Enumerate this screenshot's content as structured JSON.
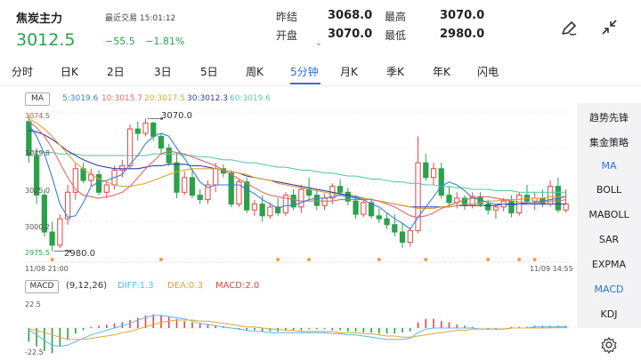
{
  "header": {
    "title": "焦炭主力",
    "last_trade": "最近交易 15:01:12",
    "price": "3012.5",
    "change": "−55.5",
    "change_pct": "−1.81%",
    "quote": {
      "prev_close_label": "昨结",
      "prev_close": "3068.0",
      "open_label": "开盘",
      "open": "3070.0",
      "high_label": "最高",
      "high": "3070.0",
      "low_label": "最低",
      "low": "2980.0"
    },
    "price_color": "#2aa14b"
  },
  "tabs": [
    {
      "label": "分时"
    },
    {
      "label": "日K"
    },
    {
      "label": "2日"
    },
    {
      "label": "3日"
    },
    {
      "label": "5日"
    },
    {
      "label": "周K"
    },
    {
      "label": "5分钟",
      "active": true
    },
    {
      "label": "月K"
    },
    {
      "label": "季K"
    },
    {
      "label": "年K"
    },
    {
      "label": "闪电"
    }
  ],
  "indicators": [
    {
      "label": "趋势先锋"
    },
    {
      "label": "集金策略"
    },
    {
      "label": "MA",
      "active": true
    },
    {
      "label": "BOLL"
    },
    {
      "label": "MABOLL"
    },
    {
      "label": "SAR"
    },
    {
      "label": "EXPMA"
    },
    {
      "label": "MACD",
      "active": true
    },
    {
      "label": "KDJ"
    }
  ],
  "icons": {
    "edit": "pen-icon",
    "collapse": "collapse-arrows-icon",
    "settings": "gear-icon"
  },
  "chart_data": [
    {
      "type": "candlestick",
      "title": "MA",
      "legend": [
        {
          "text": "5:3019.6",
          "color": "#3b7fd4"
        },
        {
          "text": "10:3015.7",
          "color": "#e06a6a"
        },
        {
          "text": "20:3017.5",
          "color": "#e3a33a"
        },
        {
          "text": "30:3012.3",
          "color": "#2c3fa8"
        },
        {
          "text": "60:3019.6",
          "color": "#5ccab0"
        }
      ],
      "y_ticks": [
        "3074.5",
        "3049.8",
        "3025.0",
        "3000.2",
        "2975.5"
      ],
      "ylim": [
        2975.5,
        3074.5
      ],
      "x_ticks": [
        "11/08 21:00",
        "11/09 14:55"
      ],
      "annotations": [
        {
          "text": "3070.0"
        },
        {
          "text": "2980.0"
        }
      ],
      "up_color": "#e04848",
      "down_color": "#2aa14b",
      "candles": [
        [
          3068,
          3072,
          3040,
          3045
        ],
        [
          3045,
          3050,
          3012,
          3018
        ],
        [
          3018,
          3022,
          2990,
          2993
        ],
        [
          2993,
          3000,
          2980,
          2984
        ],
        [
          2984,
          3005,
          2982,
          3002
        ],
        [
          3002,
          3025,
          2998,
          3020
        ],
        [
          3020,
          3040,
          3015,
          3036
        ],
        [
          3036,
          3040,
          3026,
          3028
        ],
        [
          3028,
          3036,
          3024,
          3032
        ],
        [
          3032,
          3035,
          3018,
          3020
        ],
        [
          3020,
          3027,
          3016,
          3025
        ],
        [
          3025,
          3038,
          3022,
          3035
        ],
        [
          3035,
          3042,
          3030,
          3038
        ],
        [
          3038,
          3066,
          3036,
          3063
        ],
        [
          3063,
          3068,
          3055,
          3060
        ],
        [
          3060,
          3070,
          3058,
          3067
        ],
        [
          3067,
          3068,
          3055,
          3058
        ],
        [
          3058,
          3060,
          3046,
          3050
        ],
        [
          3050,
          3053,
          3038,
          3040
        ],
        [
          3040,
          3047,
          3016,
          3020
        ],
        [
          3020,
          3034,
          3018,
          3030
        ],
        [
          3030,
          3036,
          3016,
          3018
        ],
        [
          3018,
          3022,
          3012,
          3015
        ],
        [
          3015,
          3028,
          3012,
          3025
        ],
        [
          3025,
          3040,
          3020,
          3036
        ],
        [
          3036,
          3039,
          3030,
          3033
        ],
        [
          3033,
          3035,
          3010,
          3012
        ],
        [
          3012,
          3029,
          3010,
          3027
        ],
        [
          3027,
          3030,
          3006,
          3008
        ],
        [
          3008,
          3015,
          3004,
          3012
        ],
        [
          3012,
          3018,
          3000,
          3004
        ],
        [
          3004,
          3013,
          3002,
          3010
        ],
        [
          3010,
          3016,
          3004,
          3006
        ],
        [
          3006,
          3020,
          3004,
          3018
        ],
        [
          3018,
          3022,
          3008,
          3010
        ],
        [
          3010,
          3025,
          3006,
          3022
        ],
        [
          3022,
          3030,
          3015,
          3018
        ],
        [
          3018,
          3022,
          3008,
          3011
        ],
        [
          3011,
          3019,
          3008,
          3016
        ],
        [
          3016,
          3026,
          3012,
          3024
        ],
        [
          3024,
          3029,
          3018,
          3020
        ],
        [
          3020,
          3023,
          3011,
          3014
        ],
        [
          3014,
          3018,
          3002,
          3005
        ],
        [
          3005,
          3016,
          3003,
          3013
        ],
        [
          3013,
          3016,
          3002,
          3004
        ],
        [
          3004,
          3009,
          2999,
          3002
        ],
        [
          3002,
          3006,
          2995,
          2998
        ],
        [
          2998,
          3005,
          2990,
          2993
        ],
        [
          2993,
          2999,
          2982,
          2986
        ],
        [
          2986,
          2996,
          2983,
          2994
        ],
        [
          2994,
          3058,
          2992,
          3040
        ],
        [
          3040,
          3046,
          3028,
          3030
        ],
        [
          3030,
          3040,
          3025,
          3036
        ],
        [
          3036,
          3040,
          3016,
          3018
        ],
        [
          3018,
          3024,
          3010,
          3013
        ],
        [
          3013,
          3020,
          3009,
          3016
        ],
        [
          3016,
          3018,
          3008,
          3011
        ],
        [
          3011,
          3020,
          3009,
          3017
        ],
        [
          3017,
          3020,
          3010,
          3012
        ],
        [
          3012,
          3015,
          3005,
          3008
        ],
        [
          3008,
          3012,
          3002,
          3010
        ],
        [
          3010,
          3016,
          3007,
          3014
        ],
        [
          3014,
          3018,
          3003,
          3006
        ],
        [
          3006,
          3020,
          3004,
          3018
        ],
        [
          3018,
          3025,
          3012,
          3014
        ],
        [
          3014,
          3020,
          3008,
          3016
        ],
        [
          3016,
          3022,
          3010,
          3012
        ],
        [
          3012,
          3028,
          3010,
          3024
        ],
        [
          3024,
          3030,
          3006,
          3008
        ],
        [
          3008,
          3022,
          3006,
          3012
        ]
      ],
      "ma5": [
        3066,
        3058,
        3046,
        3030,
        3012,
        3003,
        3004,
        3013,
        3024,
        3027,
        3028,
        3030,
        3032,
        3039,
        3045,
        3053,
        3058,
        3060,
        3058,
        3050,
        3043,
        3035,
        3027,
        3023,
        3025,
        3025,
        3025,
        3025,
        3022,
        3019,
        3015,
        3012,
        3009,
        3011,
        3011,
        3013,
        3015,
        3016,
        3016,
        3017,
        3018,
        3017,
        3016,
        3015,
        3012,
        3010,
        3006,
        3002,
        2999,
        2995,
        3003,
        3010,
        3017,
        3024,
        3027,
        3025,
        3021,
        3016,
        3015,
        3013,
        3012,
        3012,
        3011,
        3012,
        3013,
        3013,
        3014,
        3015,
        3016,
        3017
      ],
      "ma10": [
        3068,
        3064,
        3058,
        3050,
        3040,
        3030,
        3022,
        3018,
        3017,
        3016,
        3017,
        3018,
        3020,
        3024,
        3030,
        3036,
        3041,
        3046,
        3048,
        3047,
        3046,
        3044,
        3042,
        3040,
        3038,
        3035,
        3032,
        3029,
        3026,
        3023,
        3020,
        3018,
        3017,
        3016,
        3015,
        3014,
        3014,
        3014,
        3014,
        3014,
        3015,
        3015,
        3015,
        3015,
        3015,
        3014,
        3012,
        3010,
        3007,
        3004,
        3003,
        3004,
        3006,
        3009,
        3011,
        3013,
        3015,
        3016,
        3017,
        3017,
        3016,
        3015,
        3014,
        3013,
        3013,
        3013,
        3013,
        3014,
        3014,
        3015
      ],
      "ma20": [
        3070,
        3067,
        3063,
        3058,
        3052,
        3046,
        3040,
        3036,
        3032,
        3029,
        3027,
        3025,
        3024,
        3024,
        3025,
        3026,
        3028,
        3030,
        3032,
        3034,
        3035,
        3036,
        3036,
        3036,
        3036,
        3035,
        3034,
        3033,
        3032,
        3030,
        3029,
        3028,
        3026,
        3025,
        3024,
        3023,
        3022,
        3021,
        3020,
        3019,
        3018,
        3017,
        3016,
        3016,
        3015,
        3014,
        3013,
        3012,
        3011,
        3010,
        3009,
        3009,
        3009,
        3010,
        3010,
        3011,
        3012,
        3012,
        3013,
        3014,
        3014,
        3015,
        3015,
        3015,
        3016,
        3016,
        3016,
        3017,
        3017,
        3017
      ],
      "ma30": [
        3062,
        3061,
        3059,
        3056,
        3052,
        3048,
        3045,
        3042,
        3040,
        3038,
        3037,
        3036,
        3036,
        3036,
        3036,
        3037,
        3038,
        3038,
        3039,
        3039,
        3039,
        3038,
        3038,
        3037,
        3036,
        3035,
        3034,
        3033,
        3031,
        3030,
        3029,
        3028,
        3027,
        3026,
        3025,
        3024,
        3023,
        3022,
        3021,
        3020,
        3019,
        3018,
        3017,
        3016,
        3015,
        3014,
        3013,
        3012,
        3011,
        3010,
        3010,
        3010,
        3010,
        3010,
        3010,
        3011,
        3011,
        3011,
        3011,
        3011,
        3011,
        3012,
        3012,
        3012,
        3012,
        3012,
        3012,
        3012,
        3012,
        3012
      ],
      "ma60": [
        3048,
        3048,
        3047,
        3047,
        3046,
        3046,
        3046,
        3045,
        3045,
        3045,
        3045,
        3045,
        3045,
        3045,
        3045,
        3045,
        3046,
        3046,
        3046,
        3046,
        3045,
        3045,
        3044,
        3044,
        3043,
        3042,
        3042,
        3041,
        3040,
        3040,
        3039,
        3038,
        3037,
        3037,
        3036,
        3035,
        3035,
        3034,
        3033,
        3033,
        3032,
        3031,
        3031,
        3030,
        3029,
        3029,
        3028,
        3027,
        3027,
        3026,
        3026,
        3025,
        3025,
        3024,
        3024,
        3023,
        3023,
        3022,
        3022,
        3022,
        3021,
        3021,
        3021,
        3020,
        3020,
        3020,
        3020,
        3020,
        3020,
        3020
      ],
      "markers": [
        3,
        17,
        32,
        36,
        45,
        51,
        59,
        63,
        65
      ]
    },
    {
      "type": "macd",
      "title": "MACD",
      "params": "(9,12,26)",
      "legend": [
        {
          "text": "DIFF:1.3",
          "color": "#5bb6e8"
        },
        {
          "text": "DEA:0.3",
          "color": "#e3a33a"
        },
        {
          "text": "MACD:2.0",
          "color": "#e04848"
        }
      ],
      "y_ticks": [
        "22.5",
        "-22.5"
      ],
      "ylim": [
        -22.5,
        22.5
      ],
      "histogram": [
        -12,
        -16,
        -20,
        -22,
        -16,
        -10,
        -5,
        -2,
        1,
        2,
        3,
        4,
        5,
        7,
        9,
        11,
        12,
        11,
        10,
        8,
        6,
        5,
        4,
        3,
        2,
        1,
        0,
        -1,
        -2,
        -2,
        -3,
        -3,
        -3,
        -2,
        -2,
        -2,
        -1,
        -1,
        -1,
        -2,
        -2,
        -3,
        -3,
        -4,
        -4,
        -5,
        -5,
        -5,
        -4,
        -3,
        5,
        8,
        8,
        6,
        5,
        3,
        2,
        1,
        0,
        -1,
        -1,
        0,
        1,
        1,
        1,
        2,
        2,
        2,
        2,
        2
      ],
      "diff": [
        -2,
        -6,
        -11,
        -15,
        -16,
        -15,
        -12,
        -9,
        -6,
        -4,
        -2,
        0,
        2,
        4,
        7,
        9,
        11,
        11,
        10,
        9,
        8,
        6,
        4,
        3,
        2,
        1,
        0,
        -1,
        -2,
        -3,
        -3,
        -4,
        -4,
        -4,
        -4,
        -4,
        -4,
        -4,
        -4,
        -5,
        -5,
        -6,
        -6,
        -7,
        -8,
        -9,
        -10,
        -10,
        -10,
        -9,
        -4,
        -1,
        0,
        0,
        0,
        0,
        0,
        0,
        -1,
        -1,
        -1,
        -1,
        0,
        0,
        0,
        1,
        1,
        1,
        1,
        1.3
      ],
      "dea": [
        -1,
        -2,
        -4,
        -6,
        -8,
        -10,
        -10,
        -10,
        -9,
        -8,
        -7,
        -6,
        -4,
        -3,
        -1,
        1,
        3,
        5,
        6,
        7,
        7,
        7,
        6,
        6,
        5,
        4,
        3,
        2,
        1,
        1,
        0,
        -1,
        -1,
        -2,
        -2,
        -3,
        -3,
        -3,
        -3,
        -3,
        -4,
        -4,
        -4,
        -5,
        -5,
        -6,
        -7,
        -7,
        -8,
        -8,
        -7,
        -6,
        -5,
        -4,
        -3,
        -2,
        -2,
        -1,
        -1,
        -1,
        -1,
        -1,
        0,
        0,
        0,
        0,
        0,
        0.2,
        0.3,
        0.3
      ]
    }
  ]
}
